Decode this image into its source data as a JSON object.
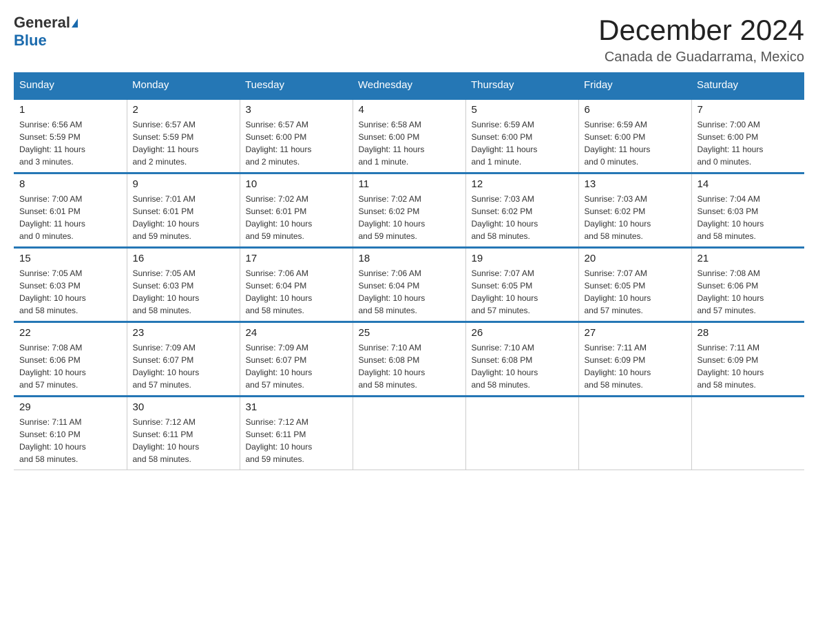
{
  "header": {
    "logo": {
      "general": "General",
      "blue": "Blue",
      "triangle": "▲"
    },
    "title": "December 2024",
    "subtitle": "Canada de Guadarrama, Mexico"
  },
  "days_of_week": [
    "Sunday",
    "Monday",
    "Tuesday",
    "Wednesday",
    "Thursday",
    "Friday",
    "Saturday"
  ],
  "weeks": [
    [
      {
        "day": "1",
        "sunrise": "6:56 AM",
        "sunset": "5:59 PM",
        "daylight": "11 hours and 3 minutes."
      },
      {
        "day": "2",
        "sunrise": "6:57 AM",
        "sunset": "5:59 PM",
        "daylight": "11 hours and 2 minutes."
      },
      {
        "day": "3",
        "sunrise": "6:57 AM",
        "sunset": "6:00 PM",
        "daylight": "11 hours and 2 minutes."
      },
      {
        "day": "4",
        "sunrise": "6:58 AM",
        "sunset": "6:00 PM",
        "daylight": "11 hours and 1 minute."
      },
      {
        "day": "5",
        "sunrise": "6:59 AM",
        "sunset": "6:00 PM",
        "daylight": "11 hours and 1 minute."
      },
      {
        "day": "6",
        "sunrise": "6:59 AM",
        "sunset": "6:00 PM",
        "daylight": "11 hours and 0 minutes."
      },
      {
        "day": "7",
        "sunrise": "7:00 AM",
        "sunset": "6:00 PM",
        "daylight": "11 hours and 0 minutes."
      }
    ],
    [
      {
        "day": "8",
        "sunrise": "7:00 AM",
        "sunset": "6:01 PM",
        "daylight": "11 hours and 0 minutes."
      },
      {
        "day": "9",
        "sunrise": "7:01 AM",
        "sunset": "6:01 PM",
        "daylight": "10 hours and 59 minutes."
      },
      {
        "day": "10",
        "sunrise": "7:02 AM",
        "sunset": "6:01 PM",
        "daylight": "10 hours and 59 minutes."
      },
      {
        "day": "11",
        "sunrise": "7:02 AM",
        "sunset": "6:02 PM",
        "daylight": "10 hours and 59 minutes."
      },
      {
        "day": "12",
        "sunrise": "7:03 AM",
        "sunset": "6:02 PM",
        "daylight": "10 hours and 58 minutes."
      },
      {
        "day": "13",
        "sunrise": "7:03 AM",
        "sunset": "6:02 PM",
        "daylight": "10 hours and 58 minutes."
      },
      {
        "day": "14",
        "sunrise": "7:04 AM",
        "sunset": "6:03 PM",
        "daylight": "10 hours and 58 minutes."
      }
    ],
    [
      {
        "day": "15",
        "sunrise": "7:05 AM",
        "sunset": "6:03 PM",
        "daylight": "10 hours and 58 minutes."
      },
      {
        "day": "16",
        "sunrise": "7:05 AM",
        "sunset": "6:03 PM",
        "daylight": "10 hours and 58 minutes."
      },
      {
        "day": "17",
        "sunrise": "7:06 AM",
        "sunset": "6:04 PM",
        "daylight": "10 hours and 58 minutes."
      },
      {
        "day": "18",
        "sunrise": "7:06 AM",
        "sunset": "6:04 PM",
        "daylight": "10 hours and 58 minutes."
      },
      {
        "day": "19",
        "sunrise": "7:07 AM",
        "sunset": "6:05 PM",
        "daylight": "10 hours and 57 minutes."
      },
      {
        "day": "20",
        "sunrise": "7:07 AM",
        "sunset": "6:05 PM",
        "daylight": "10 hours and 57 minutes."
      },
      {
        "day": "21",
        "sunrise": "7:08 AM",
        "sunset": "6:06 PM",
        "daylight": "10 hours and 57 minutes."
      }
    ],
    [
      {
        "day": "22",
        "sunrise": "7:08 AM",
        "sunset": "6:06 PM",
        "daylight": "10 hours and 57 minutes."
      },
      {
        "day": "23",
        "sunrise": "7:09 AM",
        "sunset": "6:07 PM",
        "daylight": "10 hours and 57 minutes."
      },
      {
        "day": "24",
        "sunrise": "7:09 AM",
        "sunset": "6:07 PM",
        "daylight": "10 hours and 57 minutes."
      },
      {
        "day": "25",
        "sunrise": "7:10 AM",
        "sunset": "6:08 PM",
        "daylight": "10 hours and 58 minutes."
      },
      {
        "day": "26",
        "sunrise": "7:10 AM",
        "sunset": "6:08 PM",
        "daylight": "10 hours and 58 minutes."
      },
      {
        "day": "27",
        "sunrise": "7:11 AM",
        "sunset": "6:09 PM",
        "daylight": "10 hours and 58 minutes."
      },
      {
        "day": "28",
        "sunrise": "7:11 AM",
        "sunset": "6:09 PM",
        "daylight": "10 hours and 58 minutes."
      }
    ],
    [
      {
        "day": "29",
        "sunrise": "7:11 AM",
        "sunset": "6:10 PM",
        "daylight": "10 hours and 58 minutes."
      },
      {
        "day": "30",
        "sunrise": "7:12 AM",
        "sunset": "6:11 PM",
        "daylight": "10 hours and 58 minutes."
      },
      {
        "day": "31",
        "sunrise": "7:12 AM",
        "sunset": "6:11 PM",
        "daylight": "10 hours and 59 minutes."
      },
      null,
      null,
      null,
      null
    ]
  ],
  "labels": {
    "sunrise": "Sunrise:",
    "sunset": "Sunset:",
    "daylight": "Daylight:"
  }
}
